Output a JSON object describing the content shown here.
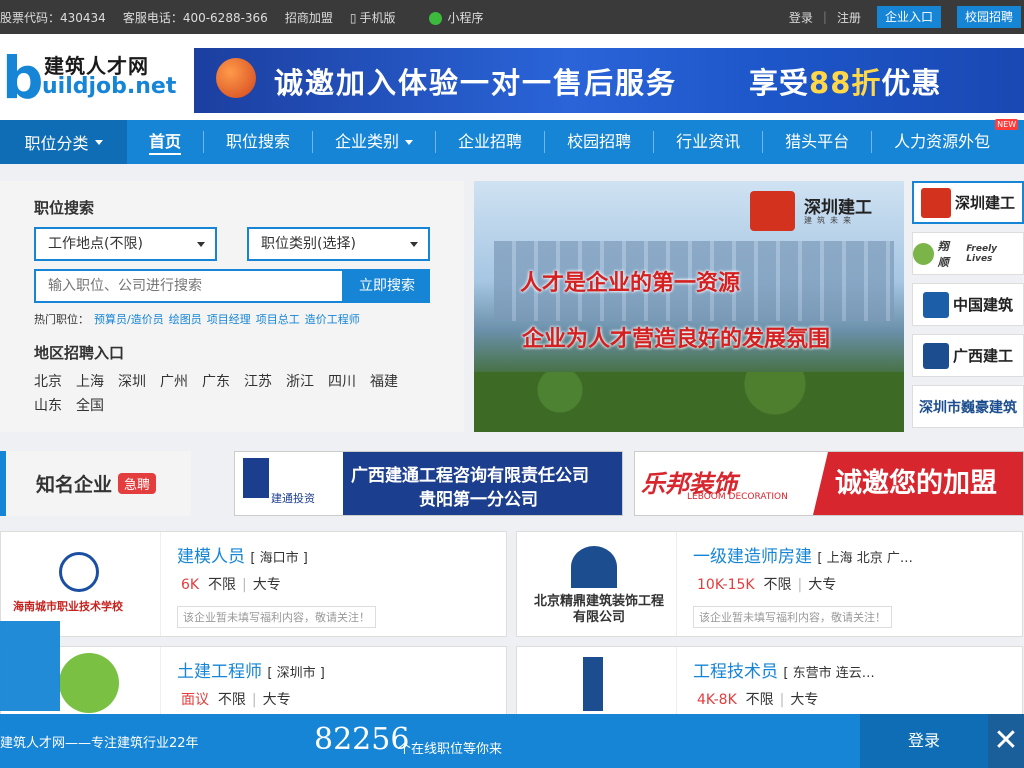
{
  "topbar": {
    "stock": "股票代码：430434",
    "hotline": "客服电话：400-6288-366",
    "join": "招商加盟",
    "mobile": "手机版",
    "miniapp": "小程序",
    "login": "登录",
    "register": "注册",
    "company_entry": "企业入口",
    "campus": "校园招聘"
  },
  "logo": {
    "cn": "建筑人才网",
    "en_b": "b",
    "en_rest": "uildjob.net"
  },
  "banner": {
    "text1": "诚邀加入体验一对一售后服务",
    "text2a": "享受",
    "text2b": "88折",
    "text2c": "优惠"
  },
  "nav": {
    "category": "职位分类",
    "items": [
      "首页",
      "职位搜索",
      "企业类别",
      "企业招聘",
      "校园招聘",
      "行业资讯",
      "猎头平台",
      "人力资源外包"
    ],
    "new_badge": "NEW"
  },
  "search": {
    "title": "职位搜索",
    "location": "工作地点(不限)",
    "jobtype": "职位类别(选择)",
    "placeholder": "输入职位、公司进行搜索",
    "button": "立即搜索",
    "hot_label": "热门职位：",
    "hot": [
      "预算员/造价员",
      "绘图员",
      "项目经理",
      "项目总工",
      "造价工程师"
    ],
    "area_title": "地区招聘入口",
    "cities": [
      "北京",
      "上海",
      "深圳",
      "广州",
      "广东",
      "江苏",
      "浙江",
      "四川",
      "福建",
      "山东",
      "全国"
    ]
  },
  "slide": {
    "logo": "深圳建工",
    "logo_sub": "建筑未来",
    "line1": "人才是企业的第一资源",
    "line2": "企业为人才营造良好的发展氛围"
  },
  "brands": [
    "深圳建工",
    "翔顺",
    "中国建筑",
    "广西建工",
    "深圳市巍豪建筑"
  ],
  "brands_sub": {
    "xiangshun": "Freely Lives"
  },
  "famous": {
    "title": "知名企业",
    "badge": "急聘"
  },
  "ad1": {
    "logo_text": "建通投资",
    "line1": "广西建通工程咨询有限责任公司",
    "line2": "贵阳第一分公司"
  },
  "ad2": {
    "brand": "乐邦装饰",
    "brand_en": "LEBOOM DECORATION",
    "slogan": "诚邀您的加盟"
  },
  "jobs": [
    {
      "title": "建模人员",
      "loc": "[ 海口市 ]",
      "salary": "6K",
      "exp": "不限",
      "edu": "大专",
      "welfare": "该企业暂未填写福利内容，敬请关注！",
      "company": "海南城市职业技术学校"
    },
    {
      "title": "一级建造师房建",
      "loc": "[ 上海 北京 广…",
      "salary": "10K-15K",
      "exp": "不限",
      "edu": "大专",
      "welfare": "该企业暂未填写福利内容，敬请关注！",
      "company": "北京精鼎建筑装饰工程有限公司"
    },
    {
      "title": "土建工程师",
      "loc": "[ 深圳市 ]",
      "salary": "面议",
      "exp": "不限",
      "edu": "大专",
      "welfare": "",
      "company": ""
    },
    {
      "title": "工程技术员",
      "loc": "[ 东营市 连云…",
      "salary": "4K-8K",
      "exp": "不限",
      "edu": "大专",
      "welfare": "",
      "company": ""
    }
  ],
  "footer": {
    "slogan": "建筑人才网——专注建筑行业22年",
    "count": "82256",
    "count_suffix": "个在线职位等你来",
    "login": "登录",
    "close": "✕"
  }
}
